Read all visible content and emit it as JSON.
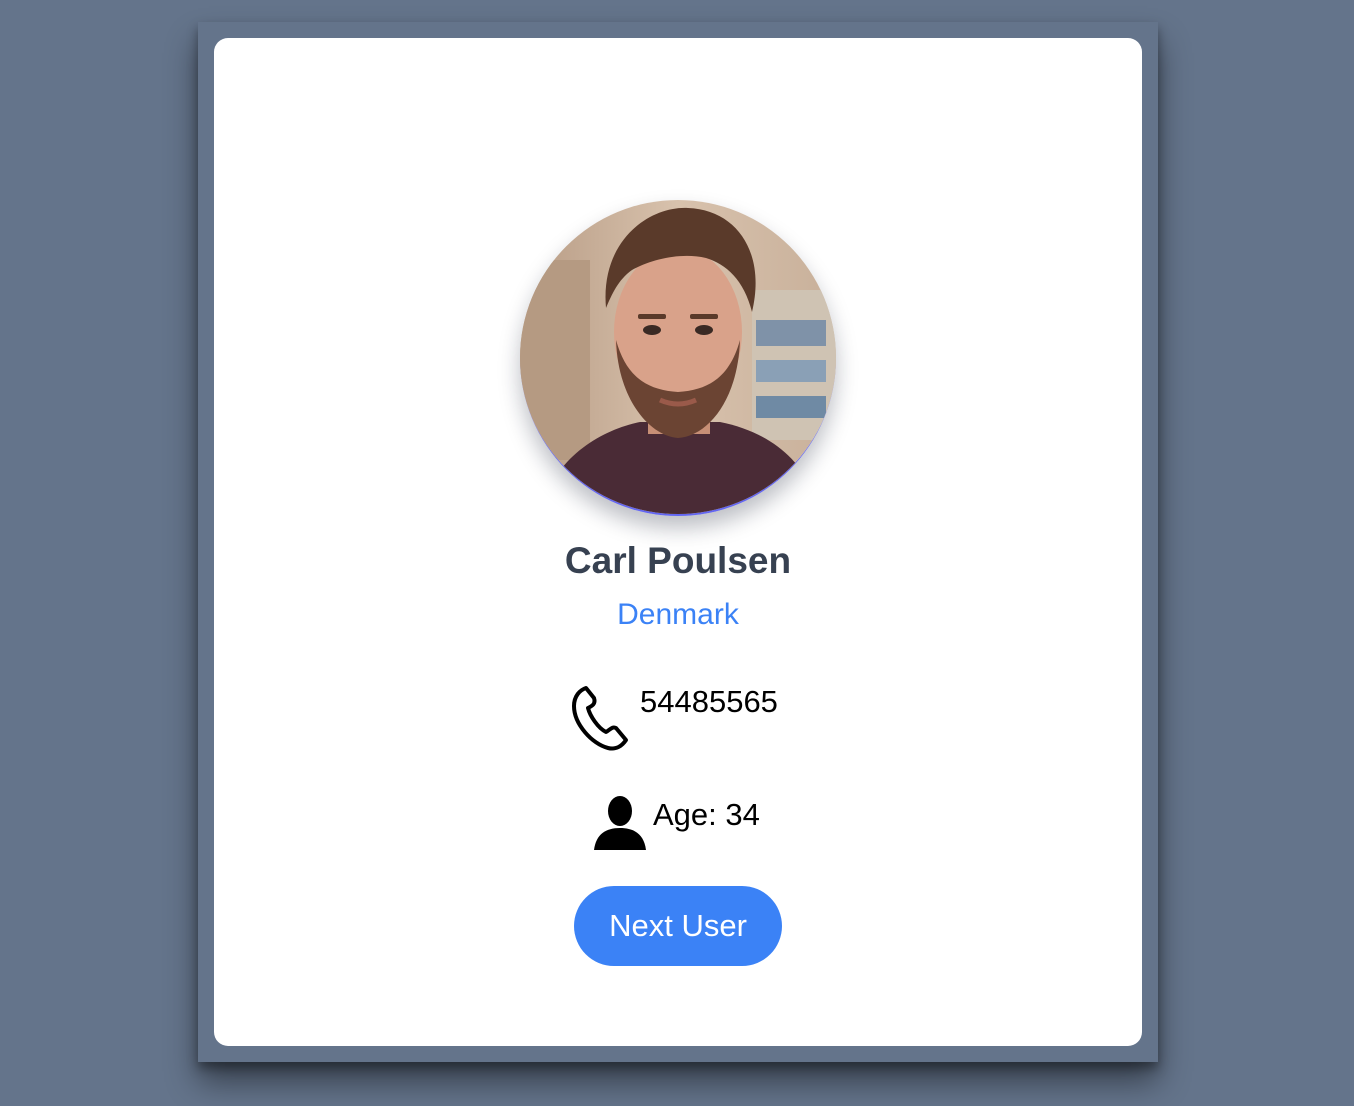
{
  "user": {
    "name": "Carl Poulsen",
    "country": "Denmark",
    "phone": "54485565",
    "age_text": "Age: 34"
  },
  "actions": {
    "next_label": "Next User"
  },
  "icons": {
    "phone": "phone-icon",
    "person": "person-icon"
  },
  "colors": {
    "background": "#64748b",
    "accent": "#3b82f6",
    "name_text": "#374151"
  }
}
